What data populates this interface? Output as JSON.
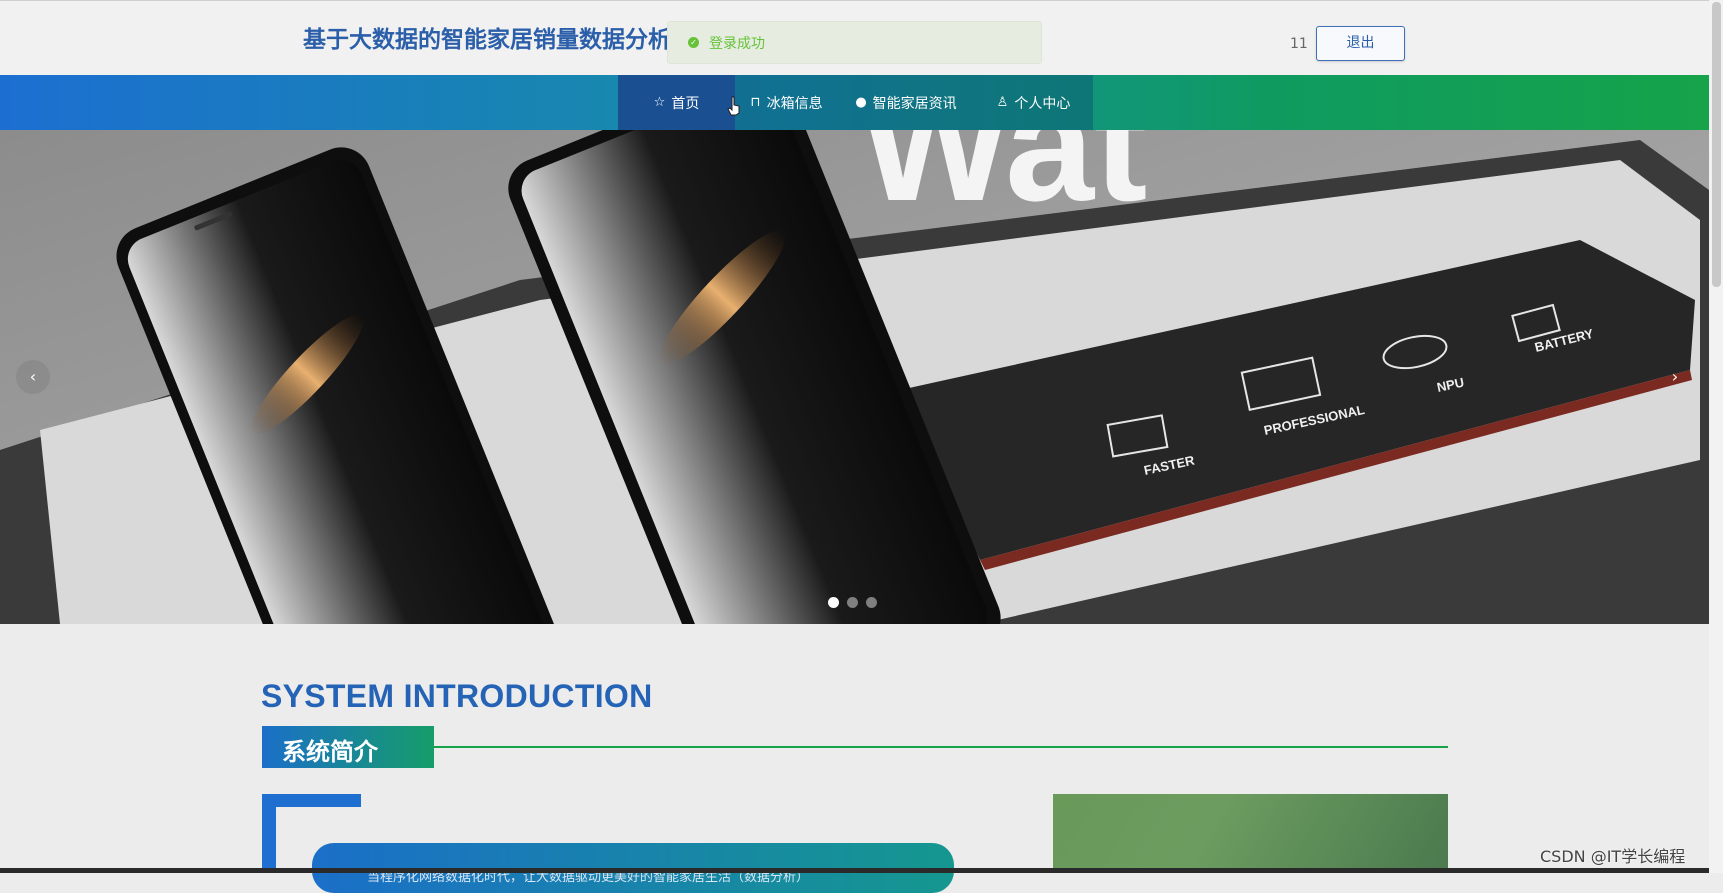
{
  "header": {
    "title": "基于大数据的智能家居销量数据分析",
    "username": "11",
    "logout_label": "退出"
  },
  "toast": {
    "message": "登录成功"
  },
  "nav": {
    "items": [
      {
        "label": "首页",
        "icon": "star-icon"
      },
      {
        "label": "冰箱信息",
        "icon": "bag-icon"
      },
      {
        "label": "智能家居资讯",
        "icon": "info-icon"
      },
      {
        "label": "个人中心",
        "icon": "user-icon"
      }
    ],
    "active_index": 0
  },
  "carousel": {
    "slide_count": 3,
    "active_slide": 0,
    "features": [
      "FASTER",
      "PROFESSIONAL",
      "NPU",
      "BATTERY"
    ]
  },
  "intro": {
    "title_en": "SYSTEM INTRODUCTION",
    "title_cn": "系统简介",
    "body_preview": "当程序化网络数据化时代，让大数据驱动更美好的智能家居生活（数据分析）"
  },
  "watermark": "CSDN @IT学长编程",
  "colors": {
    "brand_blue": "#2b5faa",
    "nav_gradient_start": "#1c6fd1",
    "nav_gradient_end": "#16a34a",
    "toast_green": "#67c23a"
  }
}
